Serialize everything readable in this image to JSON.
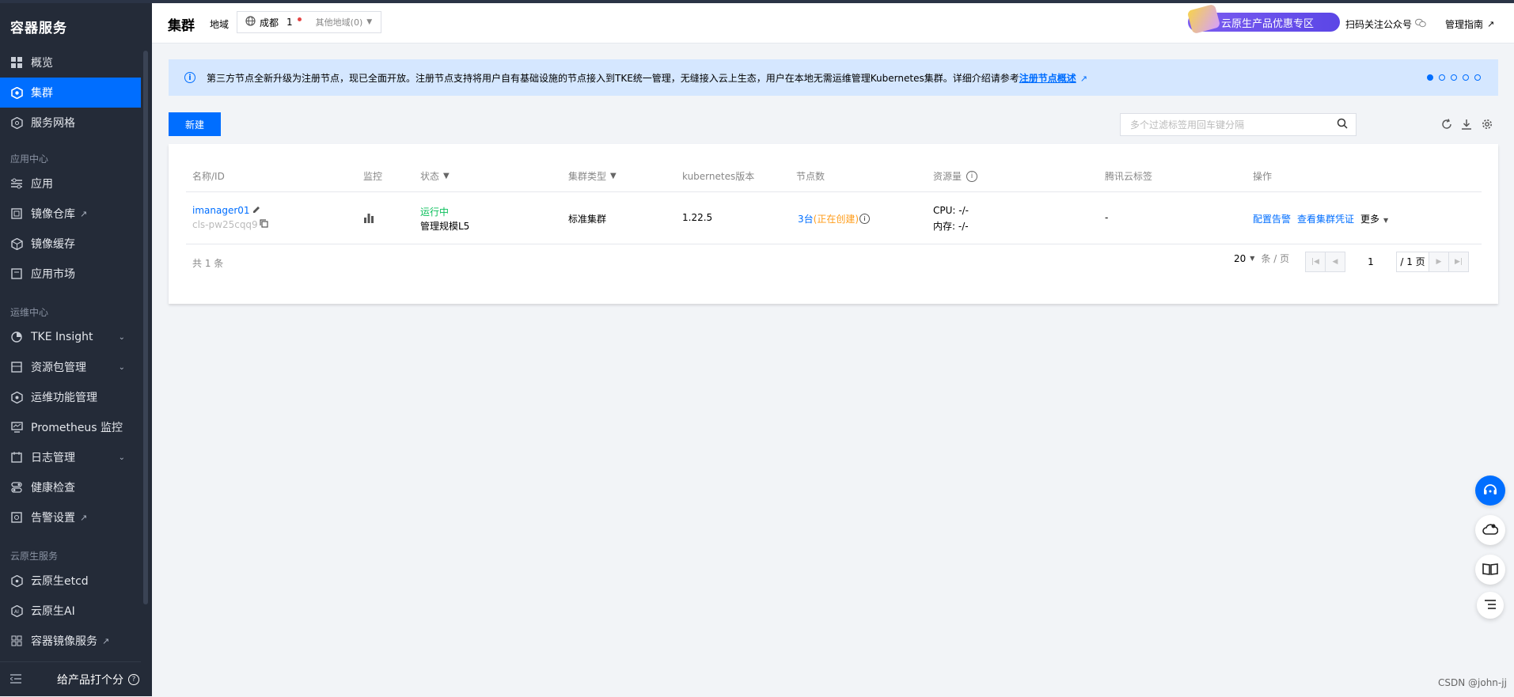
{
  "sidebar": {
    "title": "容器服务",
    "items": [
      {
        "label": "概览",
        "icon": "dashboard-icon"
      },
      {
        "label": "集群",
        "icon": "cluster-icon",
        "active": true
      },
      {
        "label": "服务网格",
        "icon": "mesh-icon"
      }
    ],
    "group_app": "应用中心",
    "app_items": [
      {
        "label": "应用"
      },
      {
        "label": "镜像仓库"
      },
      {
        "label": "镜像缓存"
      },
      {
        "label": "应用市场"
      }
    ],
    "group_ops": "运维中心",
    "ops_items": [
      {
        "label": "TKE Insight"
      },
      {
        "label": "资源包管理"
      },
      {
        "label": "运维功能管理"
      },
      {
        "label": "Prometheus 监控"
      },
      {
        "label": "日志管理"
      },
      {
        "label": "健康检查"
      },
      {
        "label": "告警设置"
      }
    ],
    "group_cloud": "云原生服务",
    "cloud_items": [
      {
        "label": "云原生etcd"
      },
      {
        "label": "云原生AI"
      },
      {
        "label": "容器镜像服务"
      }
    ],
    "rate_label": "给产品打个分"
  },
  "header": {
    "title": "集群",
    "region_label": "地域",
    "region_name": "成都",
    "region_count": "1",
    "other_regions": "其他地域(0)",
    "promo": "云原生产品优惠专区",
    "follow": "扫码关注公众号",
    "guide": "管理指南"
  },
  "notice": {
    "text": "第三方节点全新升级为注册节点，现已全面开放。注册节点支持将用户自有基础设施的节点接入到TKE统一管理，无缝接入云上生态，用户在本地无需运维管理Kubernetes集群。详细介绍请参考",
    "link": "注册节点概述"
  },
  "toolbar": {
    "new_label": "新建",
    "search_placeholder": "多个过滤标签用回车键分隔"
  },
  "table": {
    "headers": {
      "name": "名称/ID",
      "monitor": "监控",
      "status": "状态",
      "type": "集群类型",
      "version": "kubernetes版本",
      "nodes": "节点数",
      "resources": "资源量",
      "tags": "腾讯云标签",
      "ops": "操作"
    },
    "row": {
      "name": "imanager01",
      "id": "cls-pw25cqq9",
      "status": "运行中",
      "scale": "管理规模L5",
      "type": "标准集群",
      "version": "1.22.5",
      "nodes_count": "3台",
      "nodes_state": "正在创建",
      "cpu": "CPU: -/-",
      "mem": "内存: -/-",
      "tags": "-",
      "op_alarm": "配置告警",
      "op_cred": "查看集群凭证",
      "op_more": "更多"
    },
    "total": "共 1 条",
    "page_size": "20",
    "per_page": "条 / 页",
    "page": "1",
    "page_total": "/ 1 页"
  },
  "watermark": "CSDN @john-jj"
}
